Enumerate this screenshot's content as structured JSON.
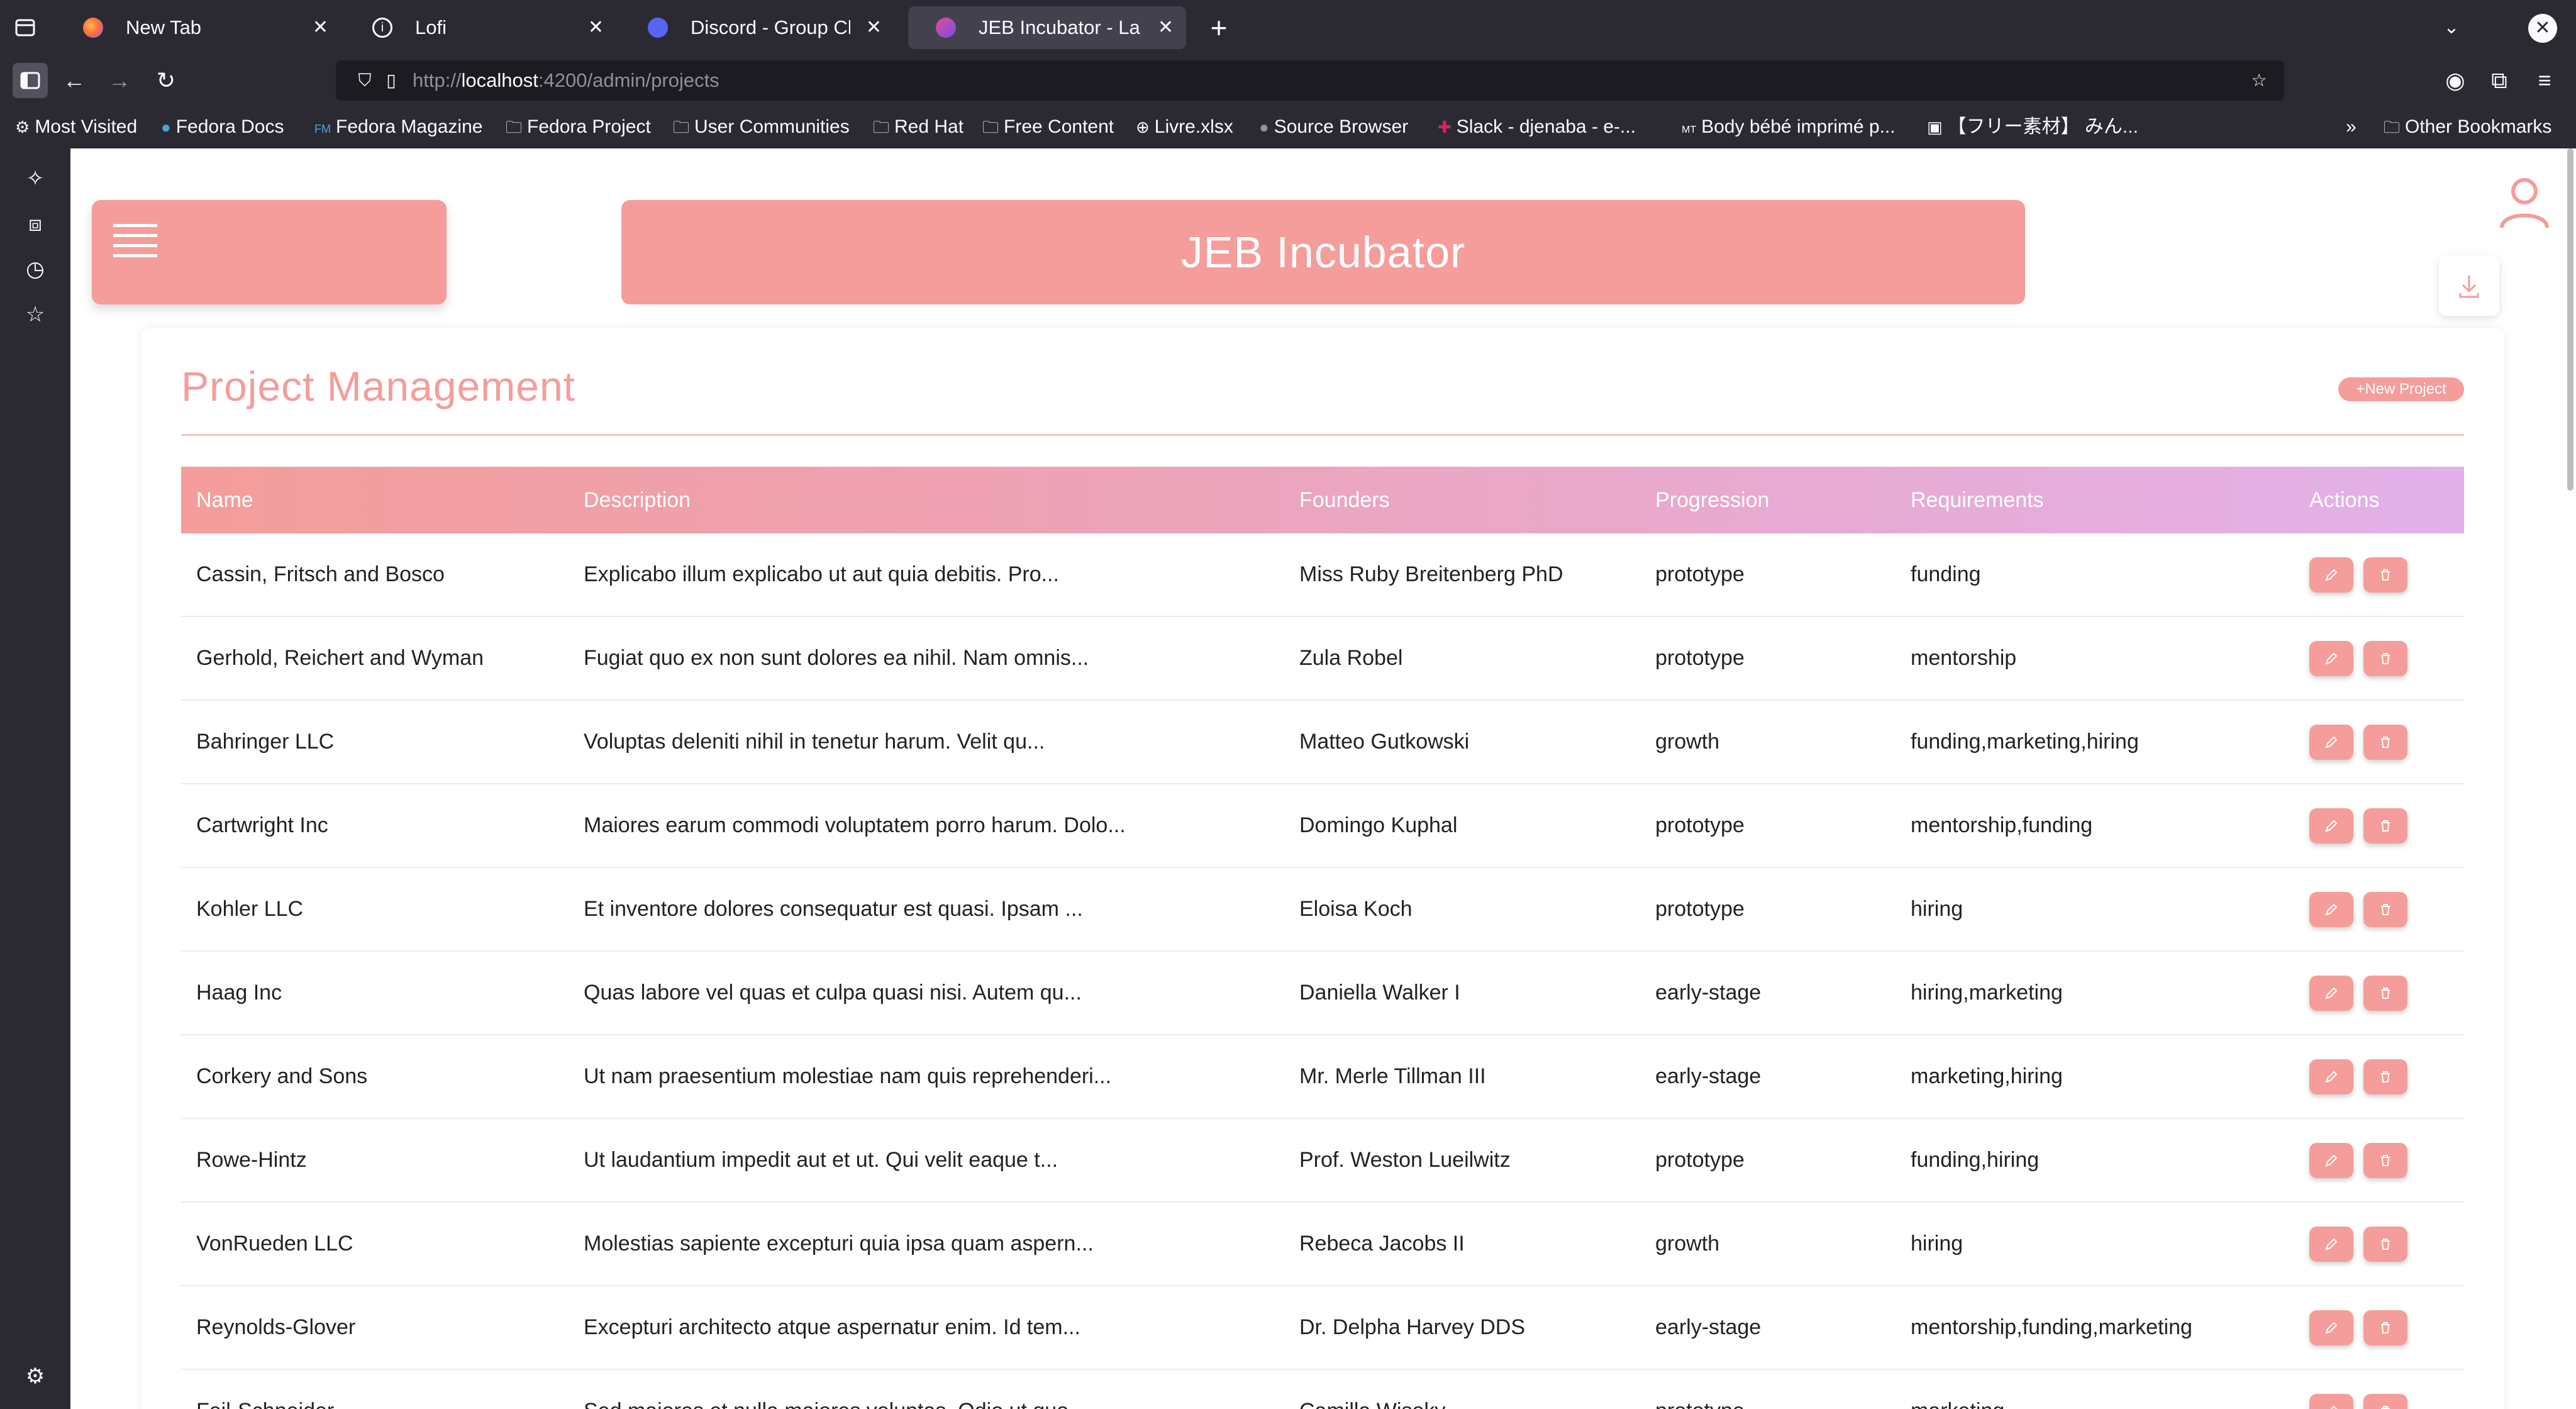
{
  "browser": {
    "tabs": [
      {
        "title": "New Tab",
        "favicon": "firefox-icon",
        "active": false
      },
      {
        "title": "Lofi",
        "favicon": "info-icon",
        "active": false
      },
      {
        "title": "Discord - Group Chat Th",
        "favicon": "discord-icon",
        "active": false
      },
      {
        "title": "JEB Incubator - La Drea",
        "favicon": "app-icon",
        "active": true
      }
    ],
    "url_scheme": "http://",
    "url_host": "localhost",
    "url_rest": ":4200/admin/projects",
    "bookmarks": [
      {
        "label": "Most Visited",
        "icon": "gear-icon"
      },
      {
        "label": "Fedora Docs",
        "icon": "fedora-icon"
      },
      {
        "label": "Fedora Magazine",
        "icon": "fm-icon"
      },
      {
        "label": "Fedora Project",
        "icon": "folder-icon"
      },
      {
        "label": "User Communities",
        "icon": "folder-icon"
      },
      {
        "label": "Red Hat",
        "icon": "folder-icon"
      },
      {
        "label": "Free Content",
        "icon": "folder-icon"
      },
      {
        "label": "Livre.xlsx",
        "icon": "globe-icon"
      },
      {
        "label": "Source Browser",
        "icon": "apple-icon"
      },
      {
        "label": "Slack - djenaba - e-...",
        "icon": "slack-icon"
      },
      {
        "label": "Body bébé imprimé p...",
        "icon": "mt-icon"
      },
      {
        "label": "【フリー素材】 みん...",
        "icon": "image-icon"
      }
    ],
    "other_bookmarks": "Other Bookmarks"
  },
  "app": {
    "header_title": "JEB Incubator",
    "page_title": "Project Management",
    "new_project_label": "New Project",
    "accent_color": "#f49d9b"
  },
  "table": {
    "columns": [
      "Name",
      "Description",
      "Founders",
      "Progression",
      "Requirements",
      "Actions"
    ],
    "rows": [
      [
        "Cassin, Fritsch and Bosco",
        "Explicabo illum explicabo ut aut quia debitis. Pro...",
        "Miss Ruby Breitenberg PhD",
        "prototype",
        "funding"
      ],
      [
        "Gerhold, Reichert and Wyman",
        "Fugiat quo ex non sunt dolores ea nihil. Nam omnis...",
        "Zula Robel",
        "prototype",
        "mentorship"
      ],
      [
        "Bahringer LLC",
        "Voluptas deleniti nihil in tenetur harum. Velit qu...",
        "Matteo Gutkowski",
        "growth",
        "funding,marketing,hiring"
      ],
      [
        "Cartwright Inc",
        "Maiores earum commodi voluptatem porro harum. Dolo...",
        "Domingo Kuphal",
        "prototype",
        "mentorship,funding"
      ],
      [
        "Kohler LLC",
        "Et inventore dolores consequatur est quasi. Ipsam ...",
        "Eloisa Koch",
        "prototype",
        "hiring"
      ],
      [
        "Haag Inc",
        "Quas labore vel quas et culpa quasi nisi. Autem qu...",
        "Daniella Walker I",
        "early-stage",
        "hiring,marketing"
      ],
      [
        "Corkery and Sons",
        "Ut nam praesentium molestiae nam quis reprehenderi...",
        "Mr. Merle Tillman III",
        "early-stage",
        "marketing,hiring"
      ],
      [
        "Rowe-Hintz",
        "Ut laudantium impedit aut et ut. Qui velit eaque t...",
        "Prof. Weston Lueilwitz",
        "prototype",
        "funding,hiring"
      ],
      [
        "VonRueden LLC",
        "Molestias sapiente excepturi quia ipsa quam aspern...",
        "Rebeca Jacobs II",
        "growth",
        "hiring"
      ],
      [
        "Reynolds-Glover",
        "Excepturi architecto atque aspernatur enim. Id tem...",
        "Dr. Delpha Harvey DDS",
        "early-stage",
        "mentorship,funding,marketing"
      ],
      [
        "Feil-Schneider",
        "Sed maiores et nulla maiores voluptas. Odio ut quo...",
        "Camilla Wisoky",
        "prototype",
        "marketing"
      ]
    ]
  }
}
